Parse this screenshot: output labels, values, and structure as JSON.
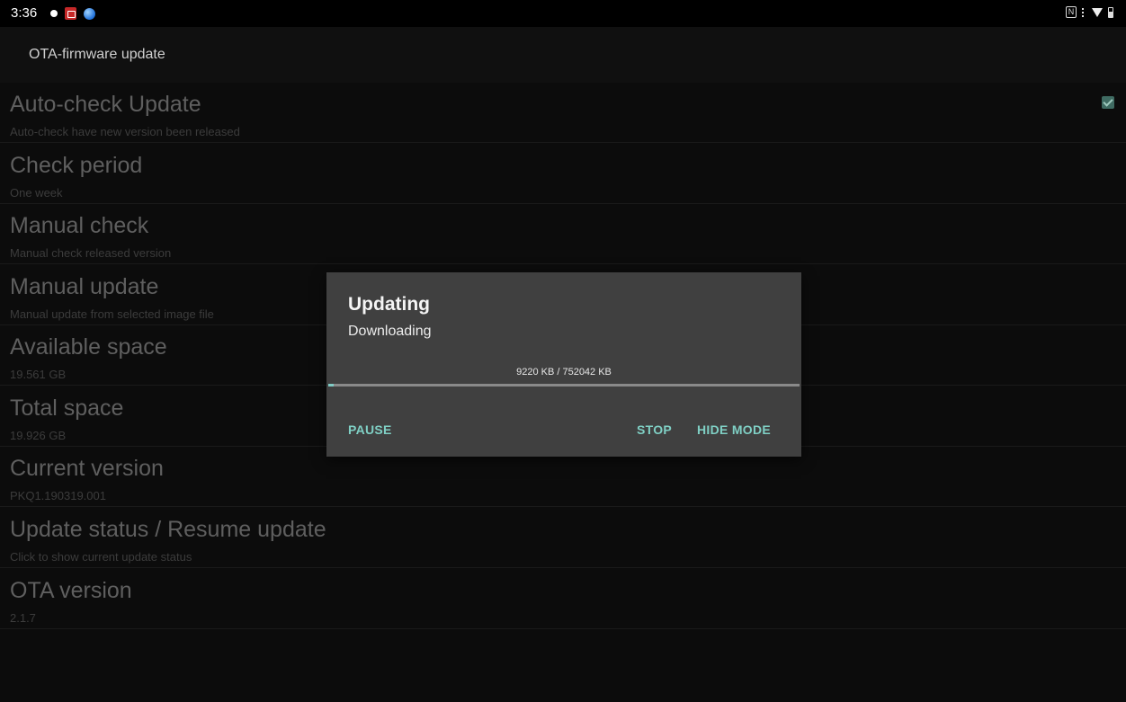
{
  "status_bar": {
    "time": "3:36",
    "left_icons": [
      "notification-dot-icon",
      "pdf-app-icon",
      "browser-globe-icon"
    ],
    "right_icons": [
      "nfc-icon",
      "vibrate-icon",
      "wifi-icon",
      "battery-icon"
    ]
  },
  "app_bar": {
    "title": "OTA-firmware update"
  },
  "preferences": [
    {
      "title": "Auto-check Update",
      "summary": "Auto-check have new version been released",
      "checked": true
    },
    {
      "title": "Check period",
      "summary": "One week"
    },
    {
      "title": "Manual check",
      "summary": "Manual check released version"
    },
    {
      "title": "Manual update",
      "summary": "Manual update from selected image file"
    },
    {
      "title": "Available space",
      "summary": "19.561 GB"
    },
    {
      "title": "Total space",
      "summary": "19.926 GB"
    },
    {
      "title": "Current version",
      "summary": "PKQ1.190319.001"
    },
    {
      "title": "Update status / Resume update",
      "summary": "Click to show current update status"
    },
    {
      "title": "OTA version",
      "summary": "2.1.7"
    }
  ],
  "dialog": {
    "title": "Updating",
    "message": "Downloading",
    "progress_text": "9220 KB / 752042 KB",
    "progress_fraction": 0.0123,
    "buttons": {
      "pause": "PAUSE",
      "stop": "STOP",
      "hide_mode": "HIDE MODE"
    }
  },
  "colors": {
    "accent": "#80cbc4",
    "dialog_bg": "#404040",
    "screen_bg": "#0c0c0c"
  }
}
